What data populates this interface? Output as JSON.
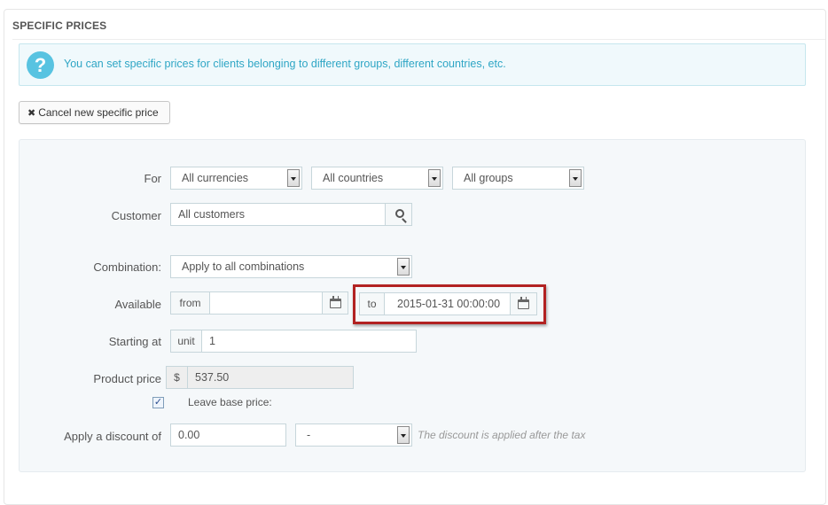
{
  "panel": {
    "title": "SPECIFIC PRICES",
    "info": "You can set specific prices for clients belonging to different groups, different countries, etc.",
    "info_icon": "?",
    "cancel_button": "Cancel new specific price",
    "cancel_icon": "✖"
  },
  "form": {
    "for_label": "For",
    "currency": "All currencies",
    "country": "All countries",
    "group": "All groups",
    "customer_label": "Customer",
    "customer_value": "All customers",
    "combination_label": "Combination:",
    "combination_value": "Apply to all combinations",
    "available_label": "Available",
    "from_label": "from",
    "from_value": "",
    "to_label": "to",
    "to_value": "2015-01-31 00:00:00",
    "starting_label": "Starting at",
    "unit_label": "unit",
    "unit_value": "1",
    "price_label": "Product price",
    "currency_symbol": "$",
    "price_value": "537.50",
    "leave_base_label": "Leave base price:",
    "leave_base_checked": true,
    "discount_label": "Apply a discount of",
    "discount_value": "0.00",
    "discount_type": "-",
    "discount_hint": "The discount is applied after the tax"
  },
  "colors": {
    "highlight": "#b22222",
    "info_text": "#2fa6c5",
    "info_icon": "#58c3e1"
  }
}
